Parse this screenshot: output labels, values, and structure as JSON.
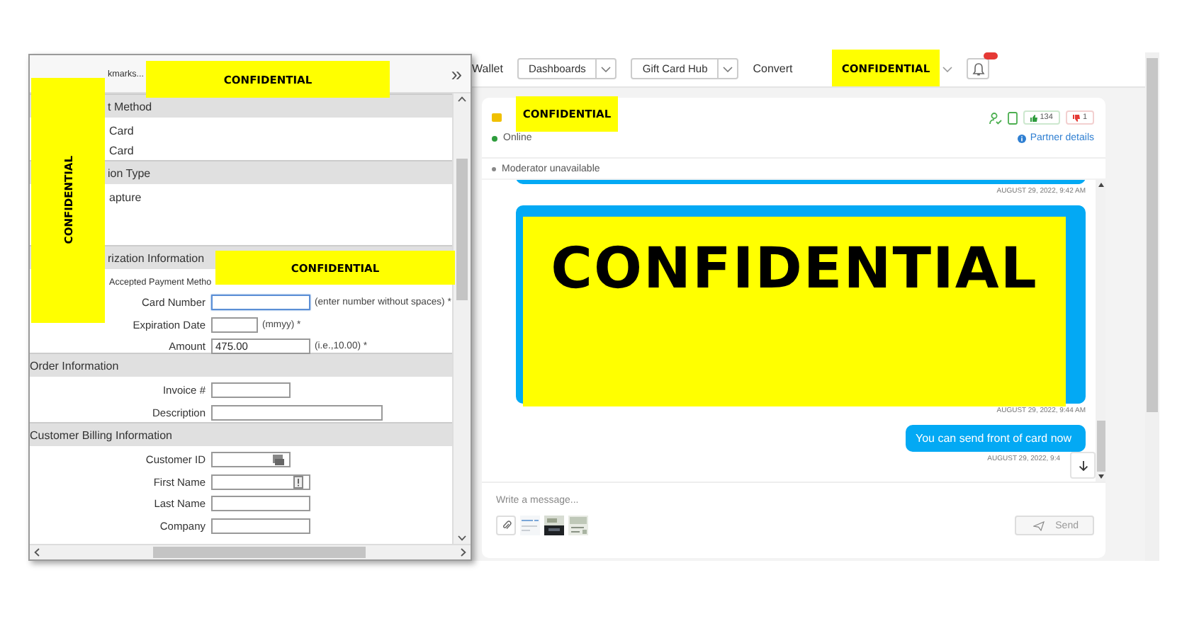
{
  "popup": {
    "toolbar": {
      "bookmarks": "kmarks...",
      "overflow": "»"
    },
    "sections": [
      {
        "title": "t Method",
        "items": [
          {
            "kind": "option",
            "text": "Card"
          },
          {
            "kind": "option",
            "text": "Card"
          }
        ]
      },
      {
        "title": "ion Type",
        "items": [
          {
            "kind": "option",
            "text": "apture"
          }
        ]
      },
      {
        "title": "rization Information",
        "items": [
          {
            "kind": "note",
            "text": "Accepted Payment Metho"
          },
          {
            "kind": "field",
            "label": "Card Number",
            "hint": "(enter number without spaces) *",
            "focused": true
          },
          {
            "kind": "field",
            "label": "Expiration Date",
            "hint": "(mmyy) *",
            "focused": false
          },
          {
            "kind": "field",
            "label": "Amount",
            "value": "475.00",
            "hint": "(i.e.,10.00) *",
            "focused": false
          }
        ]
      },
      {
        "title": "Order Information",
        "items": [
          {
            "kind": "field",
            "label": "Invoice #",
            "focused": false
          },
          {
            "kind": "field",
            "label": "Description",
            "focused": false
          }
        ]
      },
      {
        "title": "Customer Billing Information",
        "items": [
          {
            "kind": "lookup",
            "label": "Customer ID",
            "focused": false
          },
          {
            "kind": "alert",
            "label": "First Name",
            "focused": false
          },
          {
            "kind": "field",
            "label": "Last Name",
            "focused": false
          },
          {
            "kind": "field",
            "label": "Company",
            "focused": false
          }
        ]
      }
    ]
  },
  "nav": {
    "items": [
      {
        "kind": "link",
        "label": "Wallet"
      },
      {
        "kind": "dropdown",
        "label": "Dashboards"
      },
      {
        "kind": "dropdown",
        "label": "Gift Card Hub"
      },
      {
        "kind": "link",
        "label": "Convert"
      }
    ]
  },
  "chat": {
    "status": "Online",
    "likes": "134",
    "dislikes": "1",
    "partner_link": "Partner details",
    "moderator": "Moderator unavailable",
    "messages": [
      {
        "kind": "incoming",
        "time": "AUGUST 29, 2022, 9:42 AM"
      },
      {
        "kind": "incoming",
        "time": "AUGUST 29, 2022, 9:44 AM"
      },
      {
        "kind": "outgoing",
        "text": "You can send front of card now",
        "time": "AUGUST 29, 2022, 9:4"
      }
    ],
    "composer": {
      "placeholder": "Write a message...",
      "send": {
        "label": "Send",
        "disabled": true
      }
    }
  },
  "redactions": [
    {
      "text": "CONFIDENTIAL"
    },
    {
      "text": "CONFIDENTIAL"
    },
    {
      "text": "CONFIDENTIAL"
    },
    {
      "text": "CONFIDENTIAL"
    },
    {
      "text": "CONFIDENTIAL"
    },
    {
      "text": "CONFIDENTIAL"
    }
  ]
}
